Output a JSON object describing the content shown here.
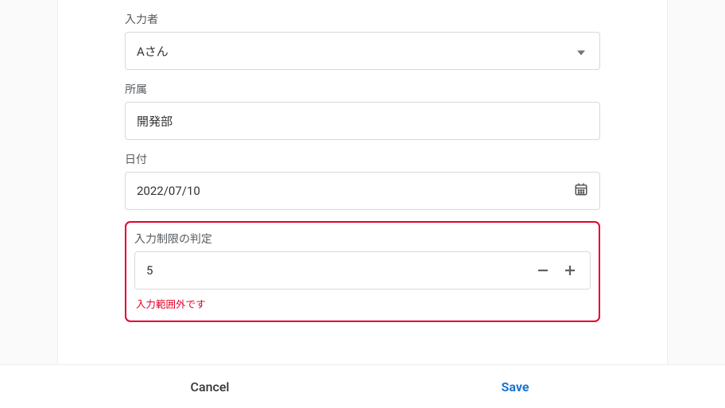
{
  "fields": {
    "input_person": {
      "label": "入力者",
      "value": "Aさん"
    },
    "department": {
      "label": "所属",
      "value": "開発部"
    },
    "date": {
      "label": "日付",
      "value": "2022/07/10"
    },
    "limit_check": {
      "label": "入力制限の判定",
      "value": "5",
      "error": "入力範囲外です"
    }
  },
  "footer": {
    "cancel": "Cancel",
    "save": "Save"
  }
}
